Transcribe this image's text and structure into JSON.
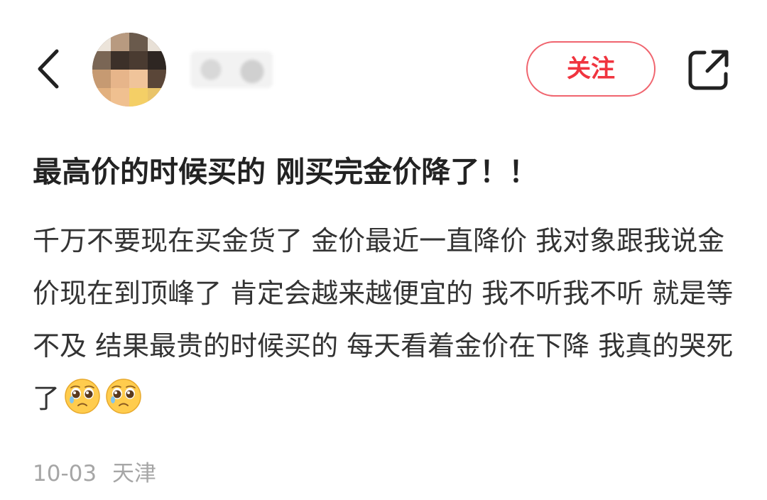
{
  "header": {
    "back_icon": "chevron-left-icon",
    "username": "·· ··",
    "follow_label": "关注",
    "share_icon": "share-external-icon",
    "accent_color": "#f0343f"
  },
  "post": {
    "title": "最高价的时候买的 刚买完金价降了！！",
    "body": "千万不要现在买金货了 金价最近一直降价 我对象跟我说金价现在到顶峰了 肯定会越来越便宜的  我不听我不听 就是等不及 结果最贵的时候买的 每天看着金价在下降 我真的哭死了",
    "emojis": [
      "pleading-face-icon",
      "pleading-face-icon"
    ],
    "date": "10-03",
    "location": "天津"
  }
}
